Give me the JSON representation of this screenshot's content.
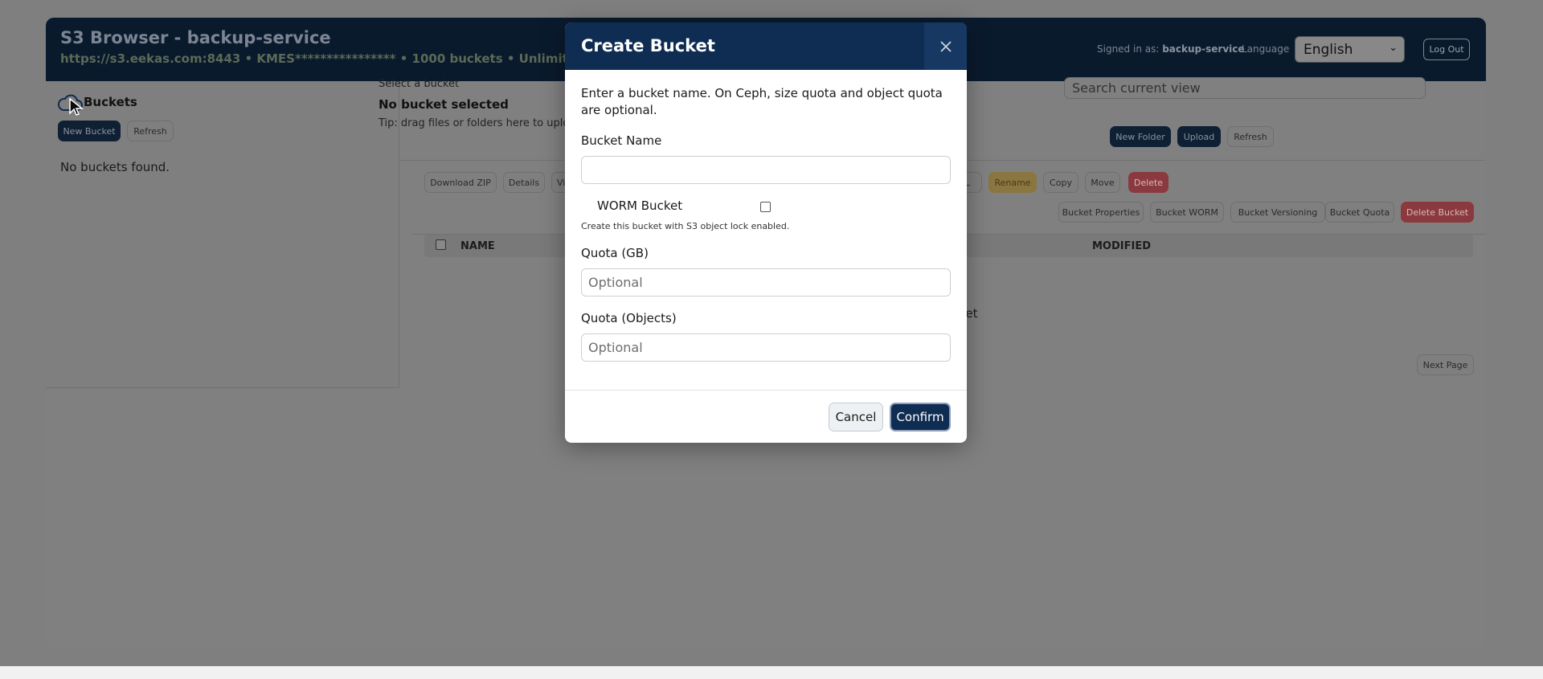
{
  "header": {
    "title": "S3 Browser - backup-service",
    "subtitle": "https://s3.eekas.com:8443 • KMES**************** • 1000 buckets • Unlimited GB",
    "signed_in_prefix": "Signed in as:",
    "signed_in_user": "backup-service",
    "language_label": "Language",
    "language_value": "English",
    "logout_label": "Log Out"
  },
  "sidebar": {
    "title": "Buckets",
    "new_bucket_label": "New Bucket",
    "refresh_label": "Refresh",
    "empty_text": "No buckets found."
  },
  "main": {
    "select_label": "Select a bucket",
    "selected_bucket": "No bucket selected",
    "tip": "Tip: drag files or folders here to upload",
    "search_placeholder": "Search current view",
    "new_folder_label": "New Folder",
    "upload_label": "Upload",
    "refresh_label": "Refresh",
    "actions": {
      "download_zip": "Download ZIP",
      "details": "Details",
      "view": "View",
      "url": "URL",
      "rename": "Rename",
      "copy": "Copy",
      "move": "Move",
      "delete": "Delete"
    },
    "bucket_actions": {
      "properties": "Bucket Properties",
      "worm": "Bucket WORM",
      "versioning": "Bucket Versioning",
      "quota": "Bucket Quota",
      "delete": "Delete Bucket"
    },
    "columns": {
      "name": "NAME",
      "modified": "MODIFIED"
    },
    "empty_text_fragment": "cket",
    "next_page_label": "Next Page"
  },
  "modal": {
    "title": "Create Bucket",
    "description": "Enter a bucket name. On Ceph, size quota and object quota are optional.",
    "bucket_name_label": "Bucket Name",
    "bucket_name_value": "",
    "worm_label": "WORM Bucket",
    "worm_help": "Create this bucket with S3 object lock enabled.",
    "quota_gb_label": "Quota (GB)",
    "quota_gb_placeholder": "Optional",
    "quota_objects_label": "Quota (Objects)",
    "quota_objects_placeholder": "Optional",
    "cancel_label": "Cancel",
    "confirm_label": "Confirm"
  },
  "colors": {
    "navy": "#0f2d52",
    "overlay": "#7f7f7f",
    "rename_amber": "#8a7640",
    "delete_red": "#8a3a3e"
  },
  "icons": {
    "close": "close-icon",
    "cloud": "cloud-icon",
    "language_chevron": "chevron-down-icon",
    "cursor": "mouse-pointer-icon"
  }
}
